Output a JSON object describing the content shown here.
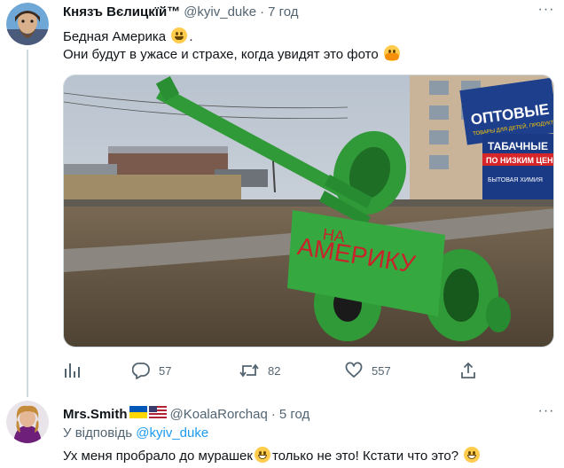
{
  "tweet1": {
    "name": "Князъ Вєлицкїй™",
    "handle": "@kyiv_duke",
    "dot": "·",
    "time": "7 год",
    "text_line1": "Бедная Америка",
    "text_line1_suffix": ".",
    "text_line2": "Они будут в ужасе и страхе, когда увидят это фото",
    "more_label": "···",
    "photo": {
      "sign_top": "ОПТОВЫЕ Ц",
      "sign_small1": "ТОВАРЫ ДЛЯ ДЕТЕЙ, ПРОДУКТЫ",
      "sign_mid": "ТАБАЧНЫЕ",
      "sign_mid2": "ПО НИЗКИМ ЦЕН",
      "sign_small2": "БЫТОВАЯ ХИМИЯ",
      "tank_text1": "НА",
      "tank_text2": "АМЕРИКУ"
    },
    "actions": {
      "analytics_icon": "analytics-icon",
      "reply_count": "57",
      "retweet_count": "82",
      "like_count": "557",
      "share_icon": "share-icon"
    }
  },
  "tweet2": {
    "name": "Mrs.Smith",
    "handle": "@KoalaRorchaq",
    "dot": "·",
    "time": "5 год",
    "reply_prefix": "У відповідь",
    "reply_handle": "@kyiv_duke",
    "text_part1": "Ух меня пробрало до мурашек",
    "text_part2": "только не это! Кстати что это?",
    "more_label": "···"
  },
  "colors": {
    "accent": "#1d9bf0",
    "secondary_text": "#536471",
    "primary_text": "#0f1419",
    "tank_green": "#2e9d3a"
  }
}
